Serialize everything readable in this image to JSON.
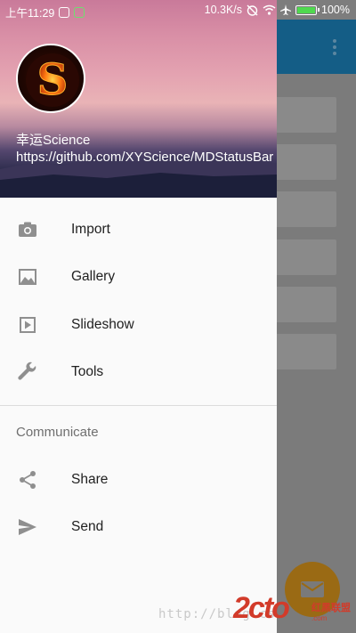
{
  "status_bar": {
    "time": "上午11:29",
    "net_speed": "10.3K/s",
    "battery_text": "100%",
    "battery_level": 1.0,
    "icons": [
      "app-badge-icon",
      "android-badge-icon",
      "alarm-off-icon",
      "wifi-icon",
      "airplane-icon",
      "battery-icon"
    ]
  },
  "drawer": {
    "header": {
      "avatar_letter": "S",
      "name": "幸运Science",
      "link": "https://github.com/XYScience/MDStatusBar"
    },
    "items": [
      {
        "label": "Import",
        "icon": "camera-icon"
      },
      {
        "label": "Gallery",
        "icon": "gallery-icon"
      },
      {
        "label": "Slideshow",
        "icon": "slideshow-icon"
      },
      {
        "label": "Tools",
        "icon": "wrench-icon"
      }
    ],
    "section_title": "Communicate",
    "section_items": [
      {
        "label": "Share",
        "icon": "share-icon"
      },
      {
        "label": "Send",
        "icon": "send-icon"
      }
    ]
  },
  "app": {
    "fab_icon": "mail-icon",
    "toolbar_color": "#145d86",
    "fab_color": "#9a6a14"
  },
  "watermark": {
    "text": "http://blog.cs",
    "logo": "2cto",
    "sub": "红黑联盟",
    "sub2": ".com"
  }
}
